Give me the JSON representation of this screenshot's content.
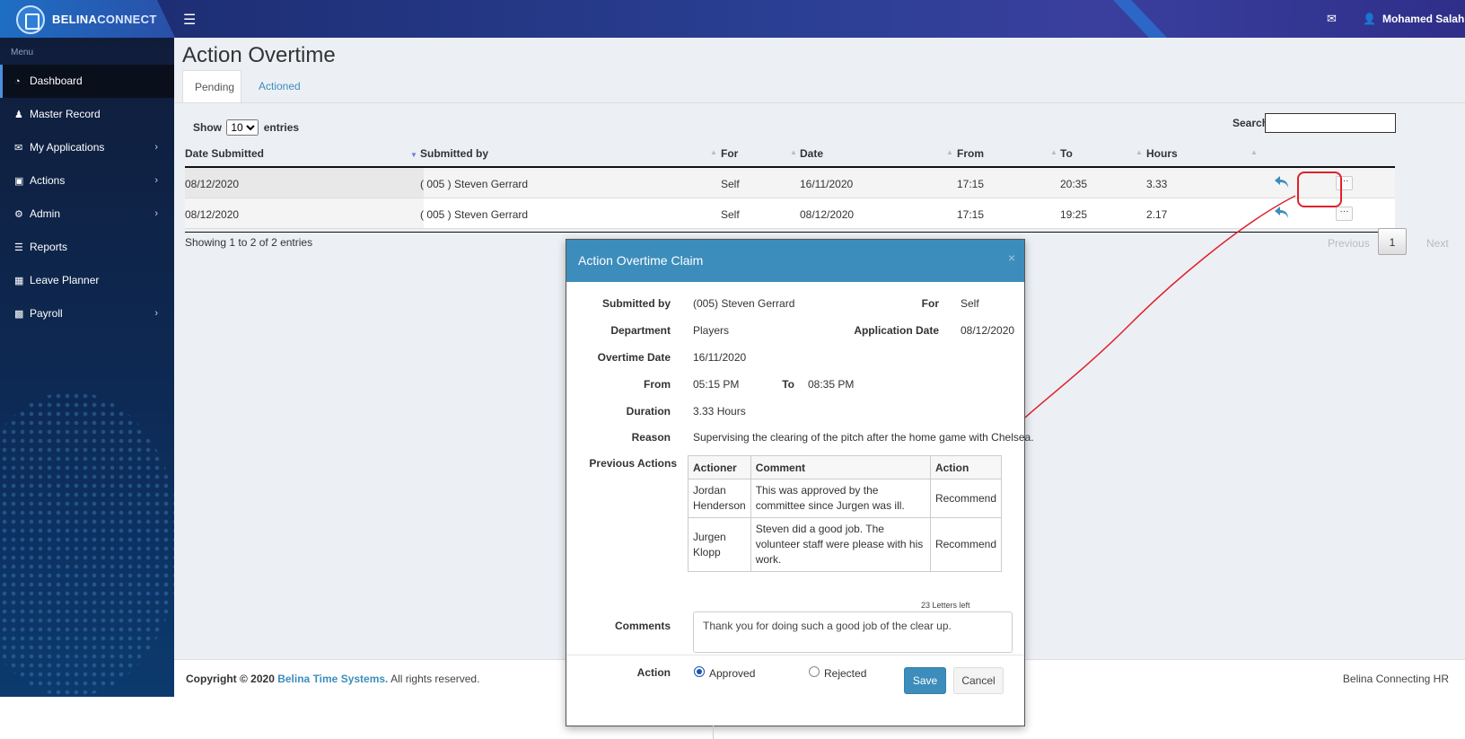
{
  "header": {
    "brand_part1": "BELINA",
    "brand_part2": "CONNECT",
    "user_name": "Mohamed Salah",
    "icons": {
      "menu": "hamburger-icon",
      "mail": "envelope-icon",
      "user": "user-icon"
    }
  },
  "sidebar": {
    "menu_label": "Menu",
    "items": [
      {
        "label": "Dashboard",
        "icon": "dashboard-icon",
        "active": true,
        "has_children": false
      },
      {
        "label": "Master Record",
        "icon": "user-icon",
        "active": false,
        "has_children": false
      },
      {
        "label": "My Applications",
        "icon": "envelope-icon",
        "active": false,
        "has_children": true
      },
      {
        "label": "Actions",
        "icon": "inbox-icon",
        "active": false,
        "has_children": true
      },
      {
        "label": "Admin",
        "icon": "gear-icon",
        "active": false,
        "has_children": true
      },
      {
        "label": "Reports",
        "icon": "book-icon",
        "active": false,
        "has_children": false
      },
      {
        "label": "Leave Planner",
        "icon": "calendar-icon",
        "active": false,
        "has_children": false
      },
      {
        "label": "Payroll",
        "icon": "money-icon",
        "active": false,
        "has_children": true
      }
    ]
  },
  "page": {
    "title": "Action Overtime",
    "tabs": [
      {
        "label": "Pending",
        "active": true
      },
      {
        "label": "Actioned",
        "active": false
      }
    ]
  },
  "table": {
    "show_label": "Show",
    "entries_label": "entries",
    "page_size": "10",
    "search_label": "Search:",
    "search_value": "",
    "columns": [
      "Date Submitted",
      "Submitted by",
      "For",
      "Date",
      "From",
      "To",
      "Hours"
    ],
    "rows": [
      {
        "date_submitted": "08/12/2020",
        "submitted_by": "( 005 )  Steven  Gerrard",
        "for": "Self",
        "date": "16/11/2020",
        "from": "17:15",
        "to": "20:35",
        "hours": "3.33"
      },
      {
        "date_submitted": "08/12/2020",
        "submitted_by": "( 005 )  Steven  Gerrard",
        "for": "Self",
        "date": "08/12/2020",
        "from": "17:15",
        "to": "19:25",
        "hours": "2.17"
      }
    ],
    "more_label": "···",
    "showing_text": "Showing 1 to 2 of 2 entries",
    "pager": {
      "previous": "Previous",
      "current": "1",
      "next": "Next"
    }
  },
  "modal": {
    "title": "Action Overtime Claim",
    "close_label": "×",
    "submitted_by_label": "Submitted by",
    "submitted_by_value": "(005) Steven Gerrard",
    "for_label": "For",
    "for_value": "Self",
    "department_label": "Department",
    "department_value": "Players",
    "application_date_label": "Application Date",
    "application_date_value": "08/12/2020",
    "overtime_date_label": "Overtime Date",
    "overtime_date_value": "16/11/2020",
    "from_label": "From",
    "from_value": "05:15 PM",
    "to_label": "To",
    "to_value": "08:35 PM",
    "duration_label": "Duration",
    "duration_value": "3.33 Hours",
    "reason_label": "Reason",
    "reason_value": "Supervising the clearing of the pitch after the home game with Chelsea.",
    "previous_actions_label": "Previous Actions",
    "previous_actions": {
      "columns": [
        "Actioner",
        "Comment",
        "Action"
      ],
      "rows": [
        {
          "actioner": "Jordan Henderson",
          "comment": "This was approved by the committee since Jurgen was ill.",
          "action": "Recommend"
        },
        {
          "actioner": "Jurgen Klopp",
          "comment": "Steven did a good job. The volunteer staff were please with his work.",
          "action": "Recommend"
        }
      ]
    },
    "letters_left": "23 Letters left",
    "comments_label": "Comments",
    "comments_value": "Thank you for doing such a good job of the clear up.",
    "action_label": "Action",
    "action_options": [
      {
        "label": "Approved",
        "checked": true
      },
      {
        "label": "Rejected",
        "checked": false
      }
    ],
    "save_label": "Save",
    "cancel_label": "Cancel"
  },
  "footer": {
    "copyright_prefix": "Copyright © 2020",
    "company": "Belina Time Systems.",
    "rights": "All rights reserved.",
    "tagline": "Belina Connecting HR"
  },
  "colors": {
    "primary": "#3c8dbc",
    "sidebar_bg": "#101d3a",
    "topbar": "#2b3f94",
    "annotation": "#e0202a"
  }
}
